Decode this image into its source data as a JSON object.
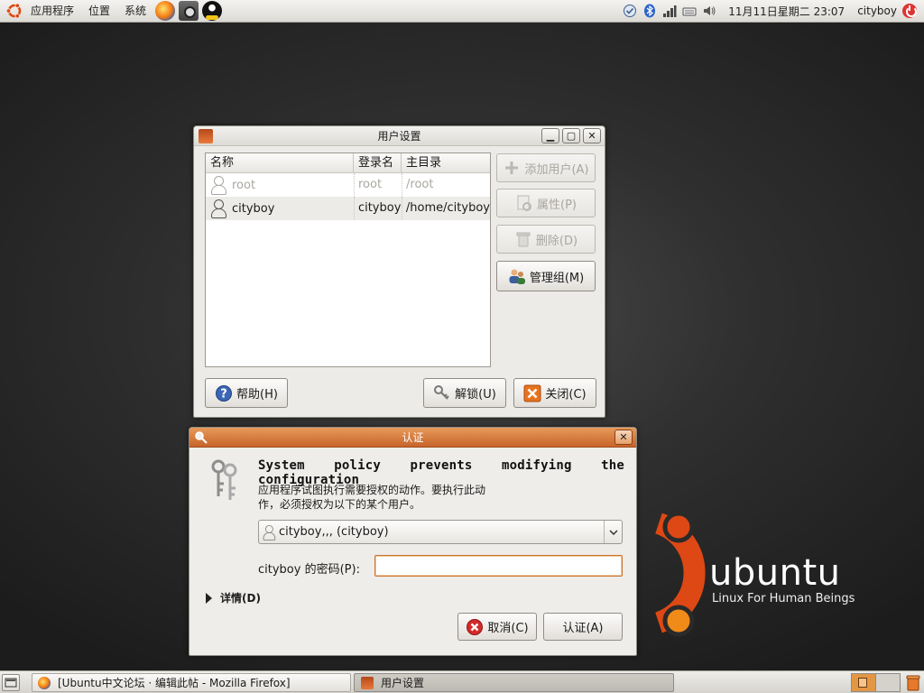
{
  "top_panel": {
    "menus": [
      "应用程序",
      "位置",
      "系统"
    ],
    "clock": "11月11日星期二 23:07",
    "user": "cityboy"
  },
  "wallpaper": {
    "wordmark": "ubuntu",
    "tagline": "Linux For Human Beings"
  },
  "users_window": {
    "title": "用户设置",
    "columns": [
      "名称",
      "登录名",
      "主目录"
    ],
    "rows": [
      {
        "name": "root",
        "login": "root",
        "home": "/root"
      },
      {
        "name": "cityboy",
        "login": "cityboy",
        "home": "/home/cityboy"
      }
    ],
    "buttons": {
      "add": "添加用户(A)",
      "properties": "属性(P)",
      "delete": "删除(D)",
      "groups": "管理组(M)",
      "help": "帮助(H)",
      "unlock": "解锁(U)",
      "close": "关闭(C)"
    }
  },
  "auth_dialog": {
    "title": "认证",
    "heading": "System policy prevents modifying the configuration",
    "description": "应用程序试图执行需要授权的动作。要执行此动作，必须授权为以下的某个用户。",
    "identity": "cityboy,,, (cityboy)",
    "password_label": "cityboy 的密码(P):",
    "password_value": "",
    "details": "详情(D)",
    "cancel": "取消(C)",
    "authenticate": "认证(A)"
  },
  "taskbar": {
    "tasks": [
      "[Ubuntu中文论坛 · 编辑此帖 - Mozilla Firefox]",
      "用户设置"
    ]
  },
  "colors": {
    "accent_orange": "#dd4814",
    "titlebar_orange": "#d9773b",
    "desktop": "#2f2f2f"
  }
}
